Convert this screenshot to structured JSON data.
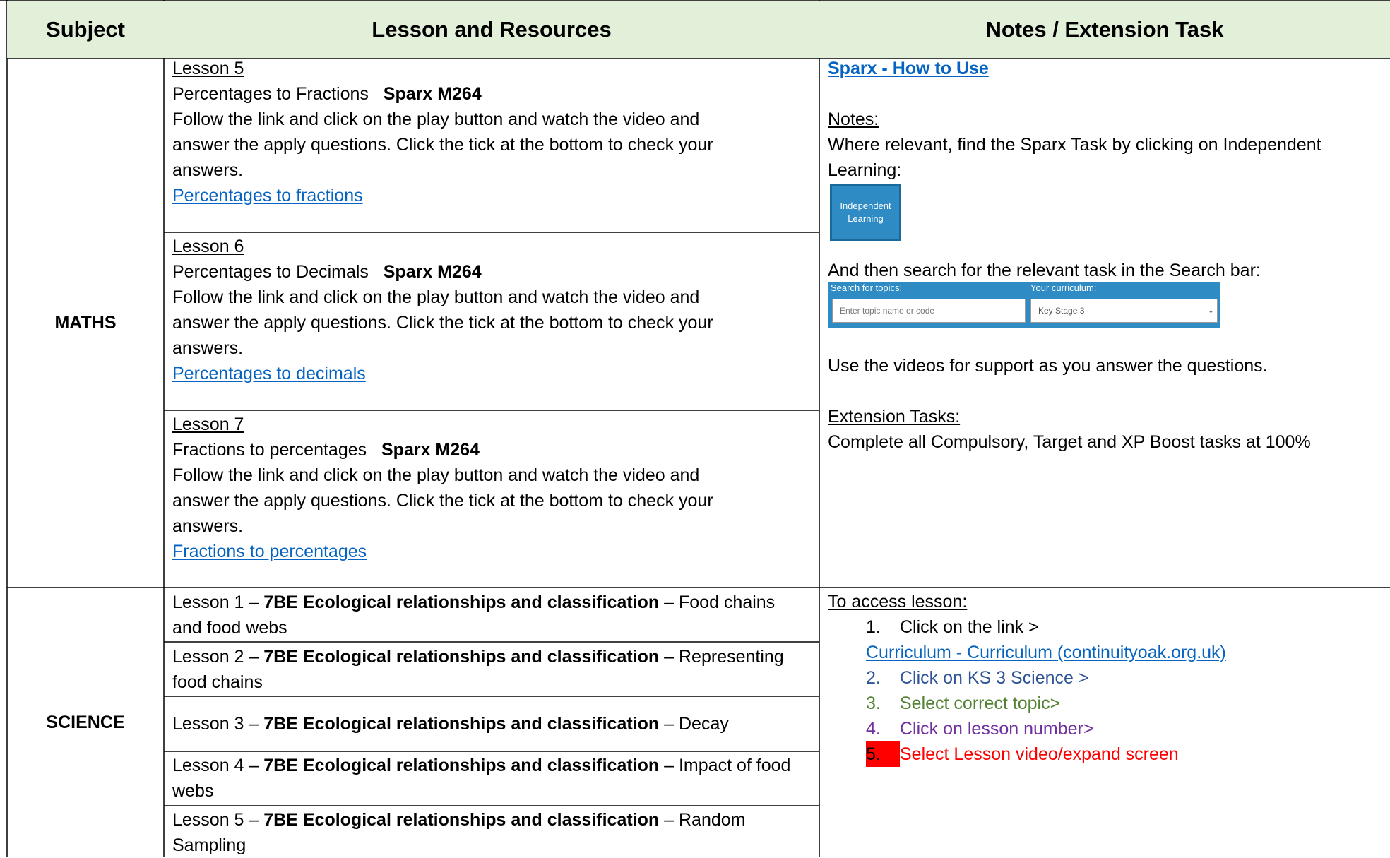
{
  "header": {
    "subject": "Subject",
    "lesson": "Lesson and Resources",
    "notes": "Notes / Extension Task"
  },
  "maths": {
    "subject": "MATHS",
    "lessons": [
      {
        "title": "Lesson 5",
        "topic": "Percentages to Fractions",
        "code": "Sparx M264",
        "line1": "Follow the link and click on the play button and watch the video and",
        "line2": "answer the apply questions. Click the tick at the bottom to check your",
        "line3": "answers.",
        "link": "Percentages to fractions"
      },
      {
        "title": "Lesson 6",
        "topic": "Percentages to Decimals",
        "code": "Sparx M264",
        "line1": "Follow the link and click on the play button and watch the video and",
        "line2": "answer the apply questions. Click the tick at the bottom to check your",
        "line3": "answers.",
        "link": "Percentages to decimals"
      },
      {
        "title": "Lesson 7",
        "topic": "Fractions to percentages",
        "code": "Sparx M264",
        "line1": "Follow the link and click on the play button and watch the video and",
        "line2": "answer the apply questions. Click the tick at the bottom to check your",
        "line3": "answers.",
        "link": "Fractions to percentages"
      }
    ],
    "notes": {
      "howto_link": "Sparx - How to Use",
      "notes_heading": "Notes:",
      "notes_line1": "Where relevant, find the Sparx Task by clicking on Independent",
      "notes_line2": "Learning:",
      "button_line1": "Independent",
      "button_line2": "Learning",
      "search_text": "And then search for the relevant task in the Search bar:",
      "search_label": "Search for topics:",
      "search_placeholder": "Enter topic name or code",
      "curriculum_label": "Your curriculum:",
      "curriculum_value": "Key Stage 3",
      "videos_text": "Use the videos for support as you answer the questions.",
      "extension_heading": "Extension Tasks:",
      "extension_text": "Complete all Compulsory, Target and XP Boost tasks at 100%"
    }
  },
  "science": {
    "subject": "SCIENCE",
    "dash": "–",
    "unit": "7BE Ecological relationships and classification",
    "lessons": [
      {
        "title": "Lesson 1",
        "topic_a": "Food chains",
        "topic_b": "and food webs"
      },
      {
        "title": "Lesson 2",
        "topic_a": "Representing",
        "topic_b": "food chains"
      },
      {
        "title": "Lesson 3",
        "topic_a": "Decay",
        "topic_b": ""
      },
      {
        "title": "Lesson 4",
        "topic_a": "Impact of food",
        "topic_b": "webs"
      },
      {
        "title": "Lesson 5",
        "topic_a": "Random",
        "topic_b": "Sampling"
      }
    ],
    "notes": {
      "access_heading": "To access lesson:",
      "step1_num": "1.",
      "step1": "Click on the link >",
      "curriculum_link": "Curriculum - Curriculum (continuityoak.org.uk)",
      "step2_num": "2.",
      "step2": "Click on KS 3 Science >",
      "step3_num": "3.",
      "step3": "Select correct topic>",
      "step4_num": "4.",
      "step4": "Click on lesson number>",
      "step5_num": "5.",
      "step5": "Select Lesson video/expand screen"
    }
  }
}
